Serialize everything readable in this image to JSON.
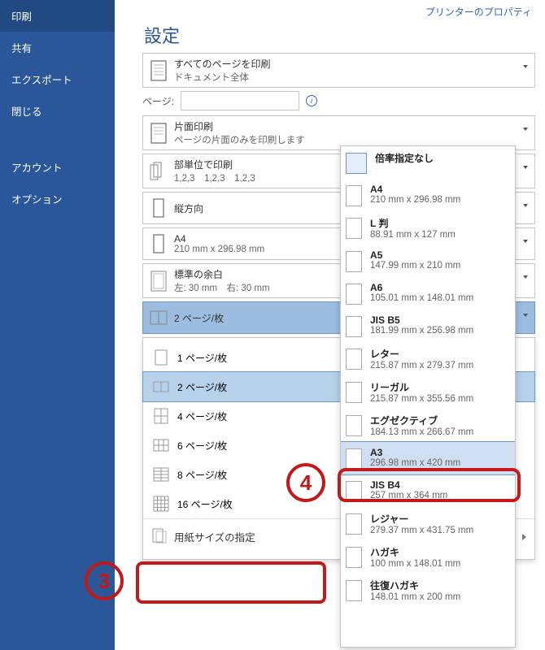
{
  "sidebar": {
    "items": [
      {
        "label": "印刷",
        "active": true
      },
      {
        "label": "共有"
      },
      {
        "label": "エクスポート"
      },
      {
        "label": "閉じる"
      }
    ],
    "lower_items": [
      {
        "label": "アカウント"
      },
      {
        "label": "オプション"
      }
    ]
  },
  "top_link": "プリンターのプロパティ",
  "section_title": "設定",
  "pages_label": "ページ:",
  "dd_all": {
    "line1": "すべてのページを印刷",
    "line2": "ドキュメント全体"
  },
  "dd_side": {
    "line1": "片面印刷",
    "line2": "ページの片面のみを印刷します"
  },
  "dd_collate": {
    "line1": "部単位で印刷",
    "line2": "1,2,3　1,2,3　1,2,3"
  },
  "dd_orient": {
    "line1": "縦方向"
  },
  "dd_paper": {
    "line1": "A4",
    "line2": "210 mm x 296.98 mm"
  },
  "dd_margin": {
    "line1": "標準の余白",
    "line2": "左: 30 mm　右: 30 mm"
  },
  "dd_pps": {
    "line1": "2 ページ/枚"
  },
  "fly_items": [
    "1 ページ/枚",
    "2 ページ/枚",
    "4 ページ/枚",
    "6 ページ/枚",
    "8 ページ/枚",
    "16 ページ/枚"
  ],
  "fly_specify": "用紙サイズの指定",
  "paper_list": [
    {
      "name": "倍率指定なし",
      "dim": "",
      "sel": true
    },
    {
      "name": "A4",
      "dim": "210 mm x 296.98 mm"
    },
    {
      "name": "L 判",
      "dim": "88.91 mm x 127 mm"
    },
    {
      "name": "A5",
      "dim": "147.99 mm x 210 mm"
    },
    {
      "name": "A6",
      "dim": "105.01 mm x 148.01 mm"
    },
    {
      "name": "JIS B5",
      "dim": "181.99 mm x 256.98 mm"
    },
    {
      "name": "レター",
      "dim": "215.87 mm x 279.37 mm"
    },
    {
      "name": "リーガル",
      "dim": "215.87 mm x 355.56 mm"
    },
    {
      "name": "エグゼクティブ",
      "dim": "184.13 mm x 266.67 mm"
    },
    {
      "name": "A3",
      "dim": "296.98 mm x 420 mm",
      "hl": true
    },
    {
      "name": "JIS B4",
      "dim": "257 mm x 364 mm"
    },
    {
      "name": "レジャー",
      "dim": "279.37 mm x 431.75 mm"
    },
    {
      "name": "ハガキ",
      "dim": "100 mm x 148.01 mm"
    },
    {
      "name": "往復ハガキ",
      "dim": "148.01 mm x 200 mm"
    }
  ],
  "callouts": {
    "c3": "3",
    "c4": "4"
  }
}
